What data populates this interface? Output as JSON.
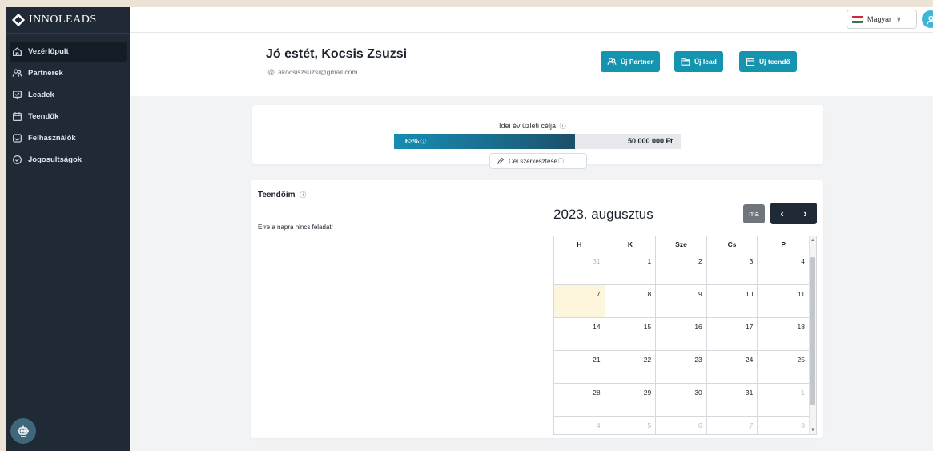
{
  "app": {
    "name": "INNOLEADS"
  },
  "sidebar": {
    "items": [
      {
        "label": "Vezérlőpult",
        "icon": "home-icon",
        "active": true
      },
      {
        "label": "Partnerek",
        "icon": "users-icon",
        "active": false
      },
      {
        "label": "Leadek",
        "icon": "leads-icon",
        "active": false
      },
      {
        "label": "Teendők",
        "icon": "calendar-icon",
        "active": false
      },
      {
        "label": "Felhasználók",
        "icon": "user-box-icon",
        "active": false
      },
      {
        "label": "Jogosultságok",
        "icon": "check-circle-icon",
        "active": false
      }
    ]
  },
  "topbar": {
    "language": "Magyar"
  },
  "header": {
    "greeting": "Jó estét, Kocsis Zsuzsi",
    "email": "akocsiszsuzsi@gmail.com",
    "buttons": {
      "new_partner": "Új Partner",
      "new_lead": "Új lead",
      "new_task": "Új teendő"
    }
  },
  "goal": {
    "title": "Idei év üzleti célja",
    "percent_label": "63%",
    "progress": 0.63,
    "amount": "50 000 000 Ft",
    "edit_label": "Cél szerkesztése"
  },
  "tasks": {
    "title": "Teendőim",
    "empty_text": "Erre a napra nincs feladat!"
  },
  "calendar": {
    "title": "2023. augusztus",
    "today_label": "ma",
    "prev": "‹",
    "next": "›",
    "weekdays": [
      "H",
      "K",
      "Sze",
      "Cs",
      "P"
    ],
    "weeks": [
      [
        "31",
        "1",
        "2",
        "3",
        "4"
      ],
      [
        "7",
        "8",
        "9",
        "10",
        "11"
      ],
      [
        "14",
        "15",
        "16",
        "17",
        "18"
      ],
      [
        "21",
        "22",
        "23",
        "24",
        "25"
      ],
      [
        "28",
        "29",
        "30",
        "31",
        "1"
      ],
      [
        "4",
        "5",
        "6",
        "7",
        "8"
      ]
    ]
  },
  "colors": {
    "sidebar": "#1f2a36",
    "accent": "#1594b0",
    "today": "#fdf6dc"
  }
}
